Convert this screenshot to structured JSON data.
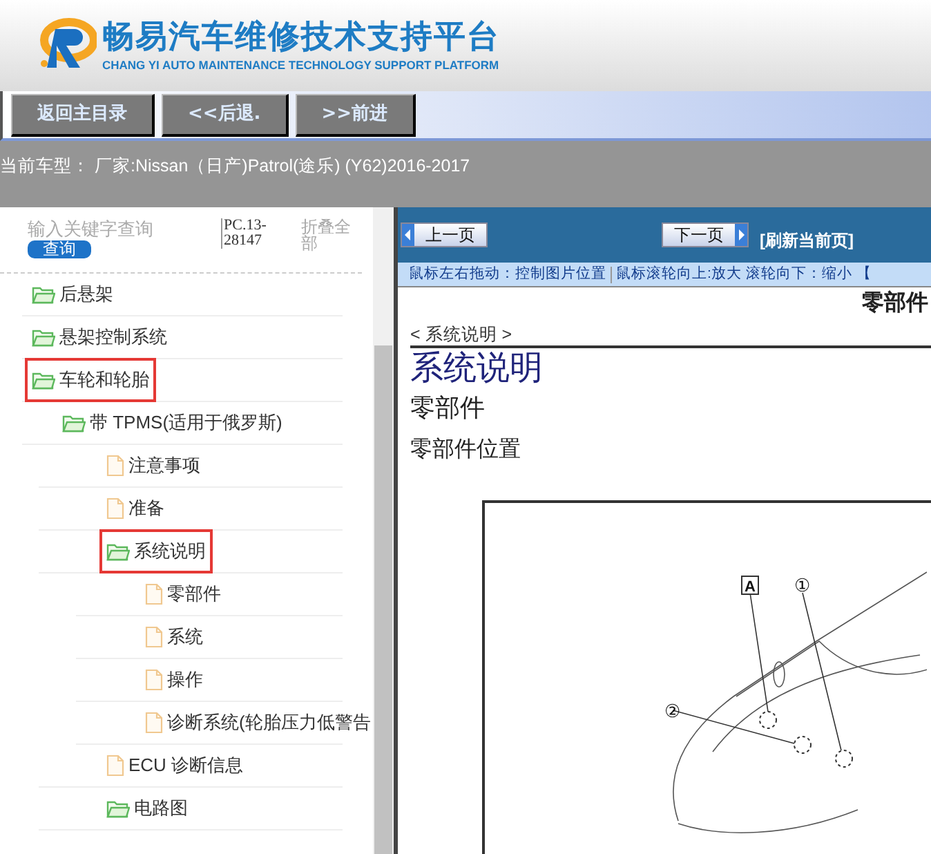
{
  "header": {
    "title": "畅易汽车维修技术支持平台",
    "subtitle": "CHANG YI AUTO MAINTENANCE TECHNOLOGY SUPPORT PLATFORM"
  },
  "toolbar": {
    "buttons": [
      "返回主目录",
      "<<后退.",
      ">>前进"
    ]
  },
  "vehicle_info": "当前车型：  厂家:Nissan（日产)Patrol(途乐) (Y62)2016-2017",
  "sidebar": {
    "search": {
      "placeholder": "输入关键字查询",
      "button": "查询"
    },
    "code": "PC.13-28147",
    "collapse_all": "折叠全部",
    "tree": [
      {
        "label": "后悬架",
        "kind": "folder",
        "highlighted": false
      },
      {
        "label": "悬架控制系统",
        "kind": "folder",
        "highlighted": false
      },
      {
        "label": "车轮和轮胎",
        "kind": "folder",
        "highlighted": true,
        "children": [
          {
            "label": "带 TPMS(适用于俄罗斯)",
            "kind": "folder",
            "highlighted": false,
            "children": [
              {
                "label": "注意事项",
                "kind": "doc",
                "highlighted": false
              },
              {
                "label": "准备",
                "kind": "doc",
                "highlighted": false
              },
              {
                "label": "系统说明",
                "kind": "folder",
                "highlighted": true,
                "children": [
                  {
                    "label": "零部件",
                    "kind": "doc",
                    "highlighted": false
                  },
                  {
                    "label": "系统",
                    "kind": "doc",
                    "highlighted": false
                  },
                  {
                    "label": "操作",
                    "kind": "doc",
                    "highlighted": false
                  },
                  {
                    "label": "诊断系统(轮胎压力低警告",
                    "kind": "doc",
                    "highlighted": false
                  }
                ]
              },
              {
                "label": "ECU 诊断信息",
                "kind": "doc",
                "highlighted": false
              },
              {
                "label": "电路图",
                "kind": "folder",
                "highlighted": false
              }
            ]
          }
        ]
      }
    ]
  },
  "viewer": {
    "prev_button": "上一页",
    "next_button": "下一页",
    "refresh_link": "[刷新当前页]",
    "hints": [
      "鼠标左右拖动：控制图片位置",
      "鼠标滚轮向上:放大",
      "滚轮向下：缩小",
      "【"
    ],
    "page_title": "零部件",
    "breadcrumb": "< 系统说明 >",
    "heading": "系统说明",
    "subheading": "零部件",
    "section": "零部件位置",
    "figure_labels": [
      "A",
      "①",
      "②"
    ]
  }
}
